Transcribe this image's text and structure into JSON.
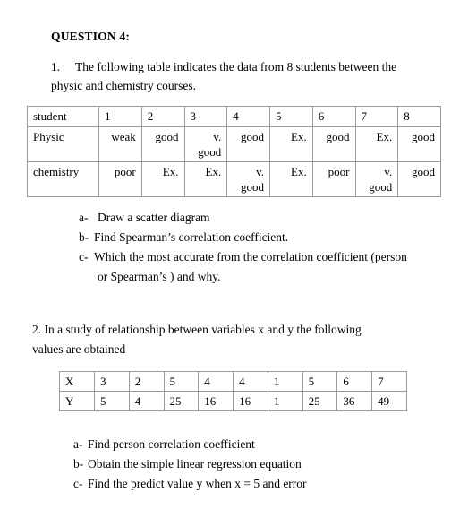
{
  "document": {
    "heading": "QUESTION 4:",
    "question1": {
      "number": "1.",
      "line1": "The following table indicates the data from 8 students between the",
      "line2": "physic and chemistry courses.",
      "table": {
        "rows": [
          {
            "label": "student",
            "values": [
              "1",
              "2",
              "3",
              "4",
              "5",
              "6",
              "7",
              "8"
            ]
          },
          {
            "label": "Physic",
            "values": [
              "weak",
              "good",
              "v. good",
              "good",
              "Ex.",
              "good",
              "Ex.",
              "good"
            ]
          },
          {
            "label": "chemistry",
            "values": [
              "poor",
              "Ex.",
              "Ex.",
              "v. good",
              "Ex.",
              "poor",
              "v. good",
              "good"
            ]
          }
        ]
      },
      "items": [
        {
          "marker": "a-",
          "text": "Draw a scatter diagram",
          "cont": ""
        },
        {
          "marker": "b-",
          "text": "Find Spearman’s correlation coefficient.",
          "cont": ""
        },
        {
          "marker": "c-",
          "text": "Which the most accurate from the correlation coefficient (person",
          "cont": "or Spearman’s ) and why."
        }
      ]
    },
    "question2": {
      "line1": "2. In a study of relationship between variables x and y the following",
      "line2": "values are obtained",
      "table": {
        "rows": [
          {
            "label": "X",
            "values": [
              "3",
              "2",
              "5",
              "4",
              "4",
              "1",
              "5",
              "6",
              "7"
            ]
          },
          {
            "label": "Y",
            "values": [
              "5",
              "4",
              "25",
              "16",
              "16",
              "1",
              "25",
              "36",
              "49"
            ]
          }
        ]
      },
      "items": [
        {
          "marker": "a-",
          "text": "Find person correlation coefficient"
        },
        {
          "marker": "b-",
          "text": "Obtain the simple linear regression equation"
        },
        {
          "marker": "c-",
          "text": "Find the predict value y when x = 5 and error"
        }
      ]
    }
  }
}
